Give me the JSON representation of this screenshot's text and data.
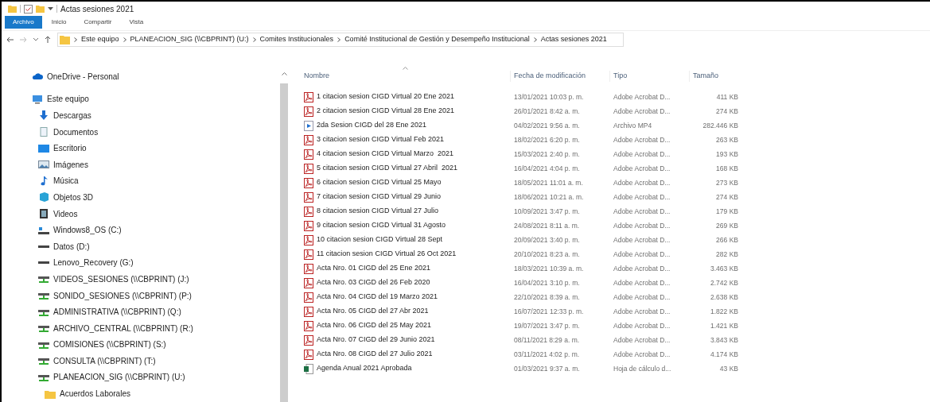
{
  "window": {
    "title": "Actas sesiones 2021"
  },
  "ribbon_tabs": [
    {
      "label": "Archivo",
      "selected": true
    },
    {
      "label": "Inicio",
      "selected": false
    },
    {
      "label": "Compartir",
      "selected": false
    },
    {
      "label": "Vista",
      "selected": false
    }
  ],
  "breadcrumb": [
    "Este equipo",
    "PLANEACION_SIG (\\\\CBPRINT) (U:)",
    "Comites Institucionales",
    "Comité Institucional de Gestión y Desempeño Institucional",
    "Actas sesiones 2021"
  ],
  "sidebar": {
    "items": [
      {
        "label": "OneDrive - Personal",
        "kind": "cloud"
      },
      {
        "label": "Este equipo",
        "kind": "pc",
        "children": [
          {
            "label": "Descargas",
            "kind": "download"
          },
          {
            "label": "Documentos",
            "kind": "docs"
          },
          {
            "label": "Escritorio",
            "kind": "desktop"
          },
          {
            "label": "Imágenes",
            "kind": "images"
          },
          {
            "label": "Música",
            "kind": "music"
          },
          {
            "label": "Objetos 3D",
            "kind": "objects"
          },
          {
            "label": "Videos",
            "kind": "videos"
          },
          {
            "label": "Windows8_OS (C:)",
            "kind": "osdrive"
          },
          {
            "label": "Datos (D:)",
            "kind": "drive"
          },
          {
            "label": "Lenovo_Recovery (G:)",
            "kind": "drive"
          },
          {
            "label": "VIDEOS_SESIONES (\\\\CBPRINT) (J:)",
            "kind": "network"
          },
          {
            "label": "SONIDO_SESIONES (\\\\CBPRINT) (P:)",
            "kind": "network"
          },
          {
            "label": "ADMINISTRATIVA (\\\\CBPRINT) (Q:)",
            "kind": "network"
          },
          {
            "label": "ARCHIVO_CENTRAL (\\\\CBPRINT) (R:)",
            "kind": "network"
          },
          {
            "label": "COMISIONES (\\\\CBPRINT) (S:)",
            "kind": "network"
          },
          {
            "label": "CONSULTA (\\\\CBPRINT) (T:)",
            "kind": "network"
          },
          {
            "label": "PLANEACION_SIG (\\\\CBPRINT) (U:)",
            "kind": "network",
            "children": [
              {
                "label": "Acuerdos Laborales",
                "kind": "folder"
              }
            ]
          }
        ]
      }
    ]
  },
  "table": {
    "columns": [
      "Nombre",
      "Fecha de modificación",
      "Tipo",
      "Tamaño"
    ],
    "rows": [
      {
        "kind": "pdf",
        "name": "1 citacion sesion CIGD Virtual 20 Ene 2021",
        "date": "13/01/2021 10:03 p. m.",
        "type": "Adobe Acrobat D...",
        "size": "411 KB"
      },
      {
        "kind": "pdf",
        "name": "2 citacion sesion CIGD Virtual 28 Ene 2021",
        "date": "26/01/2021 8:42 a. m.",
        "type": "Adobe Acrobat D...",
        "size": "274 KB"
      },
      {
        "kind": "video",
        "name": "2da Sesion CIGD del 28 Ene 2021",
        "date": "04/02/2021 9:56 a. m.",
        "type": "Archivo MP4",
        "size": "282.446 KB"
      },
      {
        "kind": "pdf",
        "name": "3 citacion sesion CIGD Virtual Feb 2021",
        "date": "18/02/2021 6:20 p. m.",
        "type": "Adobe Acrobat D...",
        "size": "263 KB"
      },
      {
        "kind": "pdf",
        "name": "4 citacion sesion CIGD Virtual Marzo  2021",
        "date": "15/03/2021 2:40 p. m.",
        "type": "Adobe Acrobat D...",
        "size": "193 KB"
      },
      {
        "kind": "pdf",
        "name": "5 citacion sesion CIGD Virtual 27 Abril  2021",
        "date": "16/04/2021 4:04 p. m.",
        "type": "Adobe Acrobat D...",
        "size": "168 KB"
      },
      {
        "kind": "pdf",
        "name": "6 citacion sesion CIGD Virtual 25 Mayo",
        "date": "18/05/2021 11:01 a. m.",
        "type": "Adobe Acrobat D...",
        "size": "273 KB"
      },
      {
        "kind": "pdf",
        "name": "7 citacion sesion CIGD Virtual 29 Junio",
        "date": "18/06/2021 10:21 a. m.",
        "type": "Adobe Acrobat D...",
        "size": "274 KB"
      },
      {
        "kind": "pdf",
        "name": "8 citacion sesion CIGD Virtual 27 Julio",
        "date": "10/09/2021 3:47 p. m.",
        "type": "Adobe Acrobat D...",
        "size": "179 KB"
      },
      {
        "kind": "pdf",
        "name": "9 citacion sesion CIGD Virtual 31 Agosto",
        "date": "24/08/2021 8:11 a. m.",
        "type": "Adobe Acrobat D...",
        "size": "269 KB"
      },
      {
        "kind": "pdf",
        "name": "10 citacion sesion CIGD Virtual 28 Sept",
        "date": "20/09/2021 3:40 p. m.",
        "type": "Adobe Acrobat D...",
        "size": "266 KB"
      },
      {
        "kind": "pdf",
        "name": "11 citacion sesion CIGD Virtual 26 Oct 2021",
        "date": "20/10/2021 8:23 a. m.",
        "type": "Adobe Acrobat D...",
        "size": "282 KB"
      },
      {
        "kind": "pdf",
        "name": "Acta Nro. 01 CIGD del 25 Ene 2021",
        "date": "18/03/2021 10:39 a. m.",
        "type": "Adobe Acrobat D...",
        "size": "3.463 KB"
      },
      {
        "kind": "pdf",
        "name": "Acta Nro. 03 CIGD del 26 Feb 2020",
        "date": "16/04/2021 3:10 p. m.",
        "type": "Adobe Acrobat D...",
        "size": "2.742 KB"
      },
      {
        "kind": "pdf",
        "name": "Acta Nro. 04 CIGD del 19 Marzo 2021",
        "date": "22/10/2021 8:39 a. m.",
        "type": "Adobe Acrobat D...",
        "size": "2.638 KB"
      },
      {
        "kind": "pdf",
        "name": "Acta Nro. 05 CIGD del 27 Abr 2021",
        "date": "16/07/2021 12:33 p. m.",
        "type": "Adobe Acrobat D...",
        "size": "1.822 KB"
      },
      {
        "kind": "pdf",
        "name": "Acta Nro. 06 CIGD del 25 May 2021",
        "date": "19/07/2021 3:47 p. m.",
        "type": "Adobe Acrobat D...",
        "size": "1.421 KB"
      },
      {
        "kind": "pdf",
        "name": "Acta Nro. 07 CIGD del 29 Junio 2021",
        "date": "08/11/2021 8:29 a. m.",
        "type": "Adobe Acrobat D...",
        "size": "3.843 KB"
      },
      {
        "kind": "pdf",
        "name": "Acta Nro. 08 CIGD del 27 Julio 2021",
        "date": "03/11/2021 4:02 p. m.",
        "type": "Adobe Acrobat D...",
        "size": "4.174 KB"
      },
      {
        "kind": "sheet",
        "name": "Agenda Anual 2021 Aprobada",
        "date": "01/03/2021 9:37 a. m.",
        "type": "Hoja de cálculo d...",
        "size": "43 KB"
      }
    ]
  }
}
